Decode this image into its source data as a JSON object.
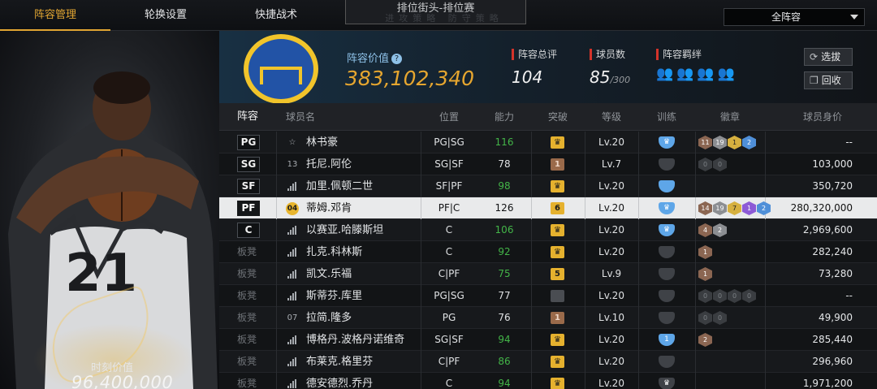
{
  "nav": {
    "tabs": [
      "阵容管理",
      "轮换设置",
      "快捷战术"
    ],
    "mode_title": "排位街头-排位赛",
    "mode_ghost": "进攻策略   防守策略",
    "filter_value": "全阵容"
  },
  "player_panel": {
    "jersey_number": "21",
    "moment_label": "时刻价值",
    "moment_value": "96,400,000"
  },
  "summary": {
    "value_label": "阵容价值",
    "value": "383,102,340",
    "rating_label": "阵容总评",
    "rating": "104",
    "players_label": "球员数",
    "players_count": "85",
    "players_max": "/300",
    "bond_label": "阵容羁绊",
    "bond_icons": [
      "👥",
      "👥",
      "👥",
      "👥"
    ],
    "btn_select": "选拔",
    "btn_recycle": "回收",
    "accent_color": "#e6a62f"
  },
  "table": {
    "headers": [
      "阵容",
      "球员名",
      "位置",
      "能力",
      "突破",
      "等级",
      "训练",
      "徽章",
      "球员身价"
    ],
    "rows": [
      {
        "slot": "PG",
        "number": "☆",
        "name": "林书豪",
        "pos": "PG|SG",
        "ability": "116",
        "green": true,
        "breakthrough": "♛",
        "bt": "gold",
        "level": "Lv.20",
        "train": "♛",
        "train_style": "blue",
        "badges": [
          [
            "11",
            "br"
          ],
          [
            "19",
            "si"
          ],
          [
            "1",
            "go"
          ],
          [
            "2",
            "bl"
          ]
        ],
        "price": "--"
      },
      {
        "slot": "SG",
        "number": "13",
        "name": "托尼.阿伦",
        "pos": "SG|SF",
        "ability": "78",
        "green": false,
        "breakthrough": "1",
        "bt": "brown",
        "level": "Lv.7",
        "train": "",
        "train_style": "gray",
        "badges": [
          [
            "0",
            "em"
          ],
          [
            "0",
            "em"
          ]
        ],
        "price": "103,000"
      },
      {
        "slot": "SF",
        "number": "bars",
        "name": "加里.佩顿二世",
        "pos": "SF|PF",
        "ability": "98",
        "green": true,
        "breakthrough": "♛",
        "bt": "gold",
        "level": "Lv.20",
        "train": "",
        "train_style": "blue",
        "badges": [],
        "price": "350,720"
      },
      {
        "slot": "PF",
        "number": "04",
        "name": "蒂姆.邓肯",
        "pos": "PF|C",
        "ability": "126",
        "green": false,
        "breakthrough": "6",
        "bt": "gold",
        "level": "Lv.20",
        "train": "♛",
        "train_style": "blue",
        "badges": [
          [
            "14",
            "br"
          ],
          [
            "19",
            "si"
          ],
          [
            "7",
            "go"
          ],
          [
            "1",
            "pu"
          ],
          [
            "2",
            "bl"
          ]
        ],
        "price": "280,320,000",
        "selected": true
      },
      {
        "slot": "C",
        "number": "bars",
        "name": "以赛亚.哈滕斯坦",
        "pos": "C",
        "ability": "106",
        "green": true,
        "breakthrough": "♛",
        "bt": "gold",
        "level": "Lv.20",
        "train": "♛",
        "train_style": "blue",
        "badges": [
          [
            "4",
            "br"
          ],
          [
            "2",
            "si"
          ]
        ],
        "price": "2,969,600"
      },
      {
        "slot": "板凳",
        "number": "bars",
        "name": "扎克.科林斯",
        "pos": "C",
        "ability": "92",
        "green": true,
        "breakthrough": "♛",
        "bt": "gold",
        "level": "Lv.20",
        "train": "",
        "train_style": "gray",
        "badges": [
          [
            "1",
            "br"
          ]
        ],
        "price": "282,240"
      },
      {
        "slot": "板凳",
        "number": "bars",
        "name": "凯文.乐福",
        "pos": "C|PF",
        "ability": "75",
        "green": true,
        "breakthrough": "5",
        "bt": "gold",
        "level": "Lv.9",
        "train": "",
        "train_style": "gray",
        "badges": [
          [
            "1",
            "br"
          ]
        ],
        "price": "73,280"
      },
      {
        "slot": "板凳",
        "number": "bars",
        "name": "斯蒂芬.库里",
        "pos": "PG|SG",
        "ability": "77",
        "green": false,
        "breakthrough": "",
        "bt": "gray",
        "level": "Lv.20",
        "train": "",
        "train_style": "gray",
        "badges": [
          [
            "0",
            "em"
          ],
          [
            "0",
            "em"
          ],
          [
            "0",
            "em"
          ],
          [
            "0",
            "em"
          ]
        ],
        "price": "--"
      },
      {
        "slot": "板凳",
        "number": "07",
        "name": "拉简.隆多",
        "pos": "PG",
        "ability": "76",
        "green": false,
        "breakthrough": "1",
        "bt": "brown",
        "level": "Lv.10",
        "train": "",
        "train_style": "gray",
        "badges": [
          [
            "0",
            "em"
          ],
          [
            "0",
            "em"
          ]
        ],
        "price": "49,900"
      },
      {
        "slot": "板凳",
        "number": "bars",
        "name": "博格丹.波格丹诺维奇",
        "pos": "SG|SF",
        "ability": "94",
        "green": true,
        "breakthrough": "♛",
        "bt": "gold",
        "level": "Lv.20",
        "train": "1",
        "train_style": "blue",
        "badges": [
          [
            "2",
            "br"
          ]
        ],
        "price": "285,440"
      },
      {
        "slot": "板凳",
        "number": "bars",
        "name": "布莱克.格里芬",
        "pos": "C|PF",
        "ability": "86",
        "green": true,
        "breakthrough": "♛",
        "bt": "gold",
        "level": "Lv.20",
        "train": "",
        "train_style": "gray",
        "badges": [],
        "price": "296,960"
      },
      {
        "slot": "板凳",
        "number": "bars",
        "name": "德安德烈.乔丹",
        "pos": "C",
        "ability": "94",
        "green": true,
        "breakthrough": "♛",
        "bt": "gold",
        "level": "Lv.20",
        "train": "♛",
        "train_style": "gray",
        "badges": [],
        "price": "1,971,200"
      }
    ]
  }
}
